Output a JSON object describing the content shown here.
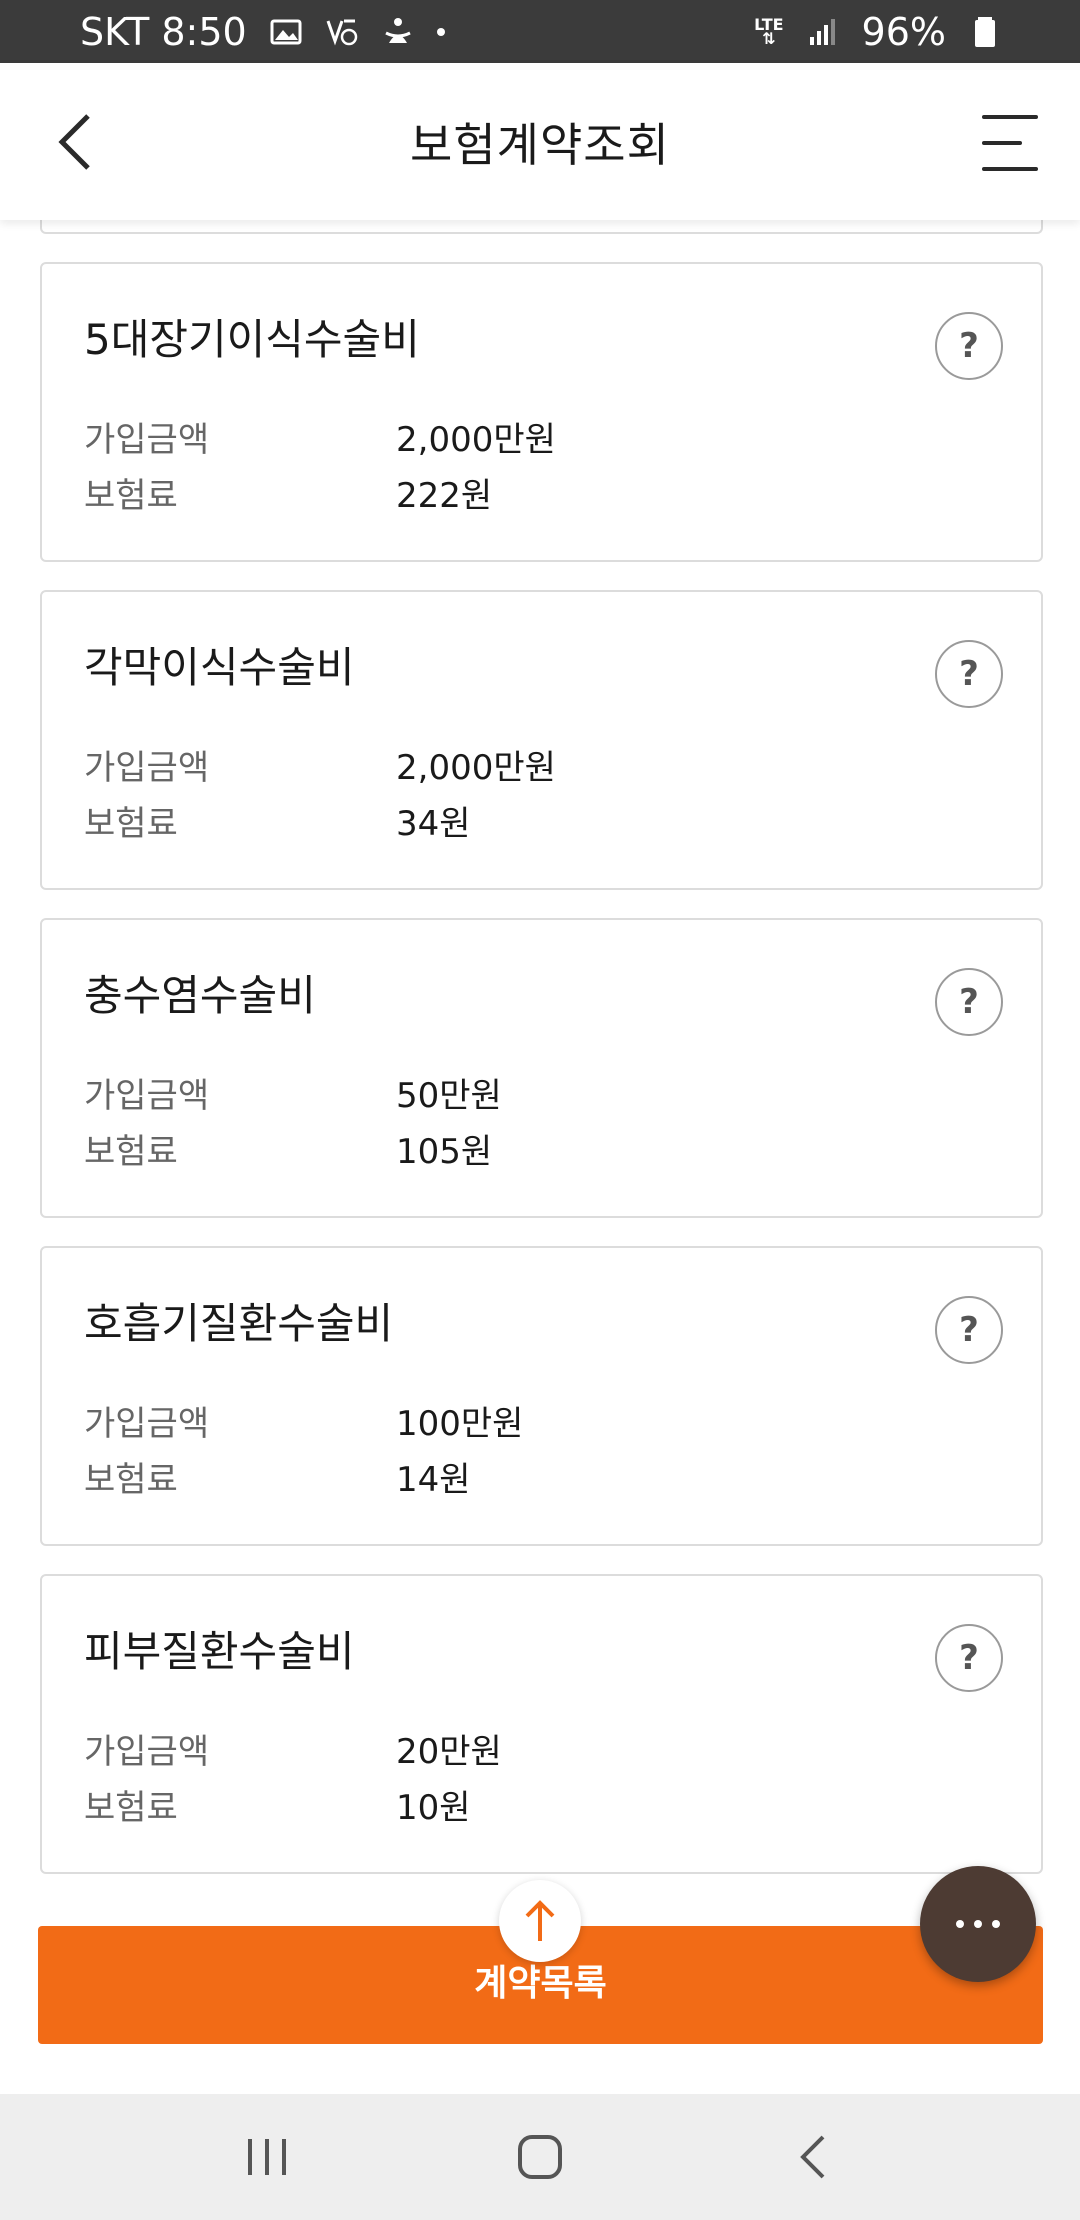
{
  "status_bar": {
    "carrier_time": "SKT 8:50",
    "network": "LTE",
    "battery": "96%",
    "icons": [
      "image-icon",
      "volte-icon",
      "accessibility-icon",
      "dot-icon",
      "signal-icon",
      "battery-icon"
    ]
  },
  "header": {
    "title": "보험계약조회",
    "back_icon": "back-arrow-icon",
    "menu_icon": "hamburger-menu-icon"
  },
  "coverages": [
    {
      "name": "5대장기이식수술비",
      "amount_label": "가입금액",
      "amount": "2,000만원",
      "premium_label": "보험료",
      "premium": "222원"
    },
    {
      "name": "각막이식수술비",
      "amount_label": "가입금액",
      "amount": "2,000만원",
      "premium_label": "보험료",
      "premium": "34원"
    },
    {
      "name": "충수염수술비",
      "amount_label": "가입금액",
      "amount": "50만원",
      "premium_label": "보험료",
      "premium": "105원"
    },
    {
      "name": "호흡기질환수술비",
      "amount_label": "가입금액",
      "amount": "100만원",
      "premium_label": "보험료",
      "premium": "14원"
    },
    {
      "name": "피부질환수술비",
      "amount_label": "가입금액",
      "amount": "20만원",
      "premium_label": "보험료",
      "premium": "10원"
    }
  ],
  "help_symbol": "?",
  "footer": {
    "contract_list_label": "계약목록",
    "scroll_top_icon": "arrow-up-icon",
    "more_icon": "more-dots-icon"
  },
  "colors": {
    "accent": "#f26b16",
    "fab": "#4d3b33",
    "status_bar": "#3b3b3b",
    "nav_bar": "#eeeeee"
  },
  "nav_bar": {
    "icons": [
      "recent-apps-icon",
      "home-icon",
      "back-icon"
    ]
  }
}
